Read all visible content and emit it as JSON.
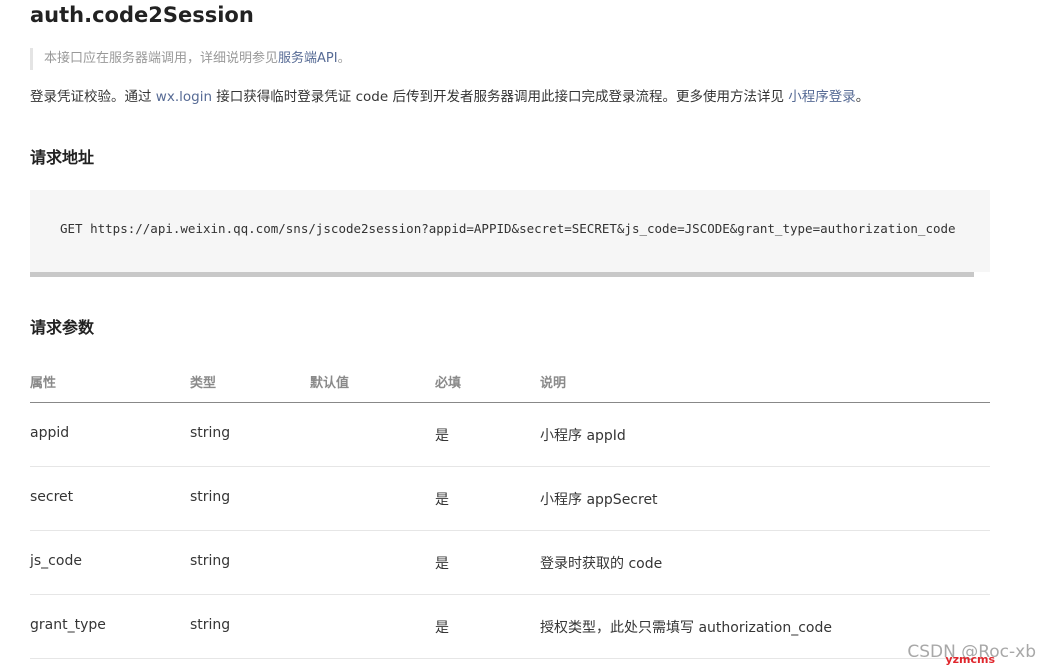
{
  "title": "auth.code2Session",
  "note": {
    "prefix": "本接口应在服务器端调用，详细说明参见",
    "link": "服务端API",
    "suffix": "。"
  },
  "intro": {
    "part1": "登录凭证校验。通过 ",
    "link1": "wx.login",
    "part2": " 接口获得临时登录凭证 code 后传到开发者服务器调用此接口完成登录流程。更多使用方法详见 ",
    "link2": "小程序登录",
    "part3": "。"
  },
  "request_url": {
    "heading": "请求地址",
    "code": "GET https://api.weixin.qq.com/sns/jscode2session?appid=APPID&secret=SECRET&js_code=JSCODE&grant_type=authorization_code"
  },
  "request_params": {
    "heading": "请求参数",
    "columns": [
      "属性",
      "类型",
      "默认值",
      "必填",
      "说明"
    ],
    "rows": [
      {
        "name": "appid",
        "type": "string",
        "default": "",
        "required": "是",
        "desc": "小程序 appId"
      },
      {
        "name": "secret",
        "type": "string",
        "default": "",
        "required": "是",
        "desc": "小程序 appSecret"
      },
      {
        "name": "js_code",
        "type": "string",
        "default": "",
        "required": "是",
        "desc": "登录时获取的 code"
      },
      {
        "name": "grant_type",
        "type": "string",
        "default": "",
        "required": "是",
        "desc": "授权类型，此处只需填写 authorization_code"
      }
    ]
  },
  "watermark": "CSDN @Roc-xb",
  "watermark2": "yzmcms",
  "colors": {
    "link": "#576b95",
    "watermark_accent": "#e0262c"
  }
}
